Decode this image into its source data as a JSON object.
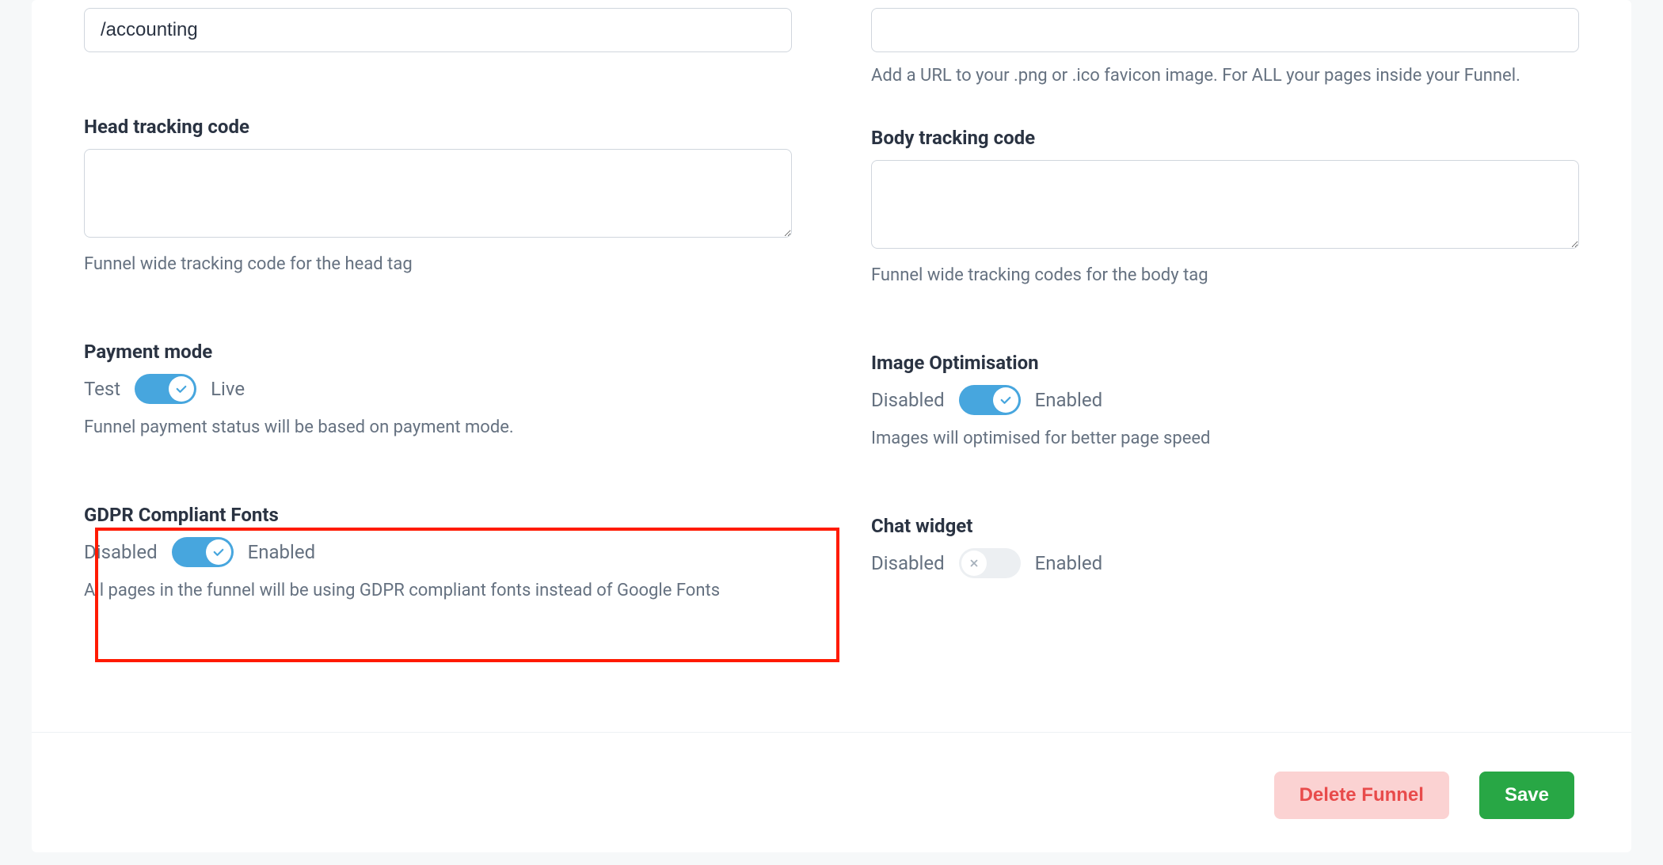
{
  "left": {
    "path_value": "/accounting",
    "head_tracking": {
      "label": "Head tracking code",
      "value": "",
      "helper": "Funnel wide tracking code for the head tag"
    },
    "payment_mode": {
      "label": "Payment mode",
      "option_off": "Test",
      "option_on": "Live",
      "on": true,
      "helper": "Funnel payment status will be based on payment mode."
    },
    "gdpr": {
      "label": "GDPR Compliant Fonts",
      "option_off": "Disabled",
      "option_on": "Enabled",
      "on": true,
      "helper": "All pages in the funnel will be using GDPR compliant fonts instead of Google Fonts"
    }
  },
  "right": {
    "favicon": {
      "value": "",
      "helper": "Add a URL to your .png or .ico favicon image. For ALL your pages inside your Funnel."
    },
    "body_tracking": {
      "label": "Body tracking code",
      "value": "",
      "helper": "Funnel wide tracking codes for the body tag"
    },
    "image_opt": {
      "label": "Image Optimisation",
      "option_off": "Disabled",
      "option_on": "Enabled",
      "on": true,
      "helper": "Images will optimised for better page speed"
    },
    "chat_widget": {
      "label": "Chat widget",
      "option_off": "Disabled",
      "option_on": "Enabled",
      "on": false
    }
  },
  "footer": {
    "delete": "Delete Funnel",
    "save": "Save"
  }
}
